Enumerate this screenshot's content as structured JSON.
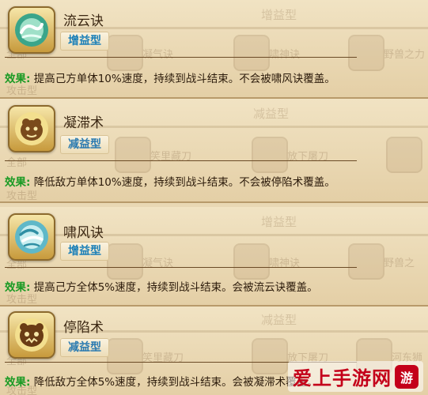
{
  "skills": [
    {
      "name": "流云诀",
      "type": "增益型",
      "effect_label": "效果:",
      "effect_text": "提高己方单体10%速度，持续到战斗结束。不会被啸风诀覆盖。",
      "icon": "cloud-swirl-icon",
      "ghost": {
        "header": "增益型",
        "left_tabs": [
          "全部",
          "攻击型"
        ],
        "cells": [
          "凝气诀",
          "啸神诀",
          "野兽之力"
        ]
      }
    },
    {
      "name": "凝滞术",
      "type": "减益型",
      "effect_label": "效果:",
      "effect_text": "降低敌方单体10%速度，持续到战斗结束。不会被停陷术覆盖。",
      "icon": "beast-claw-icon",
      "ghost": {
        "header": "减益型",
        "left_tabs": [
          "全部",
          "攻击型"
        ],
        "cells": [
          "笑里藏刀",
          "放下屠刀"
        ]
      }
    },
    {
      "name": "啸风诀",
      "type": "增益型",
      "effect_label": "效果:",
      "effect_text": "提高己方全体5%速度，持续到战斗结束。会被流云诀覆盖。",
      "icon": "wind-swirl-icon",
      "ghost": {
        "header": "增益型",
        "left_tabs": [
          "全部",
          "攻击型"
        ],
        "cells": [
          "凝气诀",
          "啸神诀",
          "野兽之"
        ]
      }
    },
    {
      "name": "停陷术",
      "type": "减益型",
      "effect_label": "效果:",
      "effect_text": "降低敌方全体5%速度，持续到战斗结束。会被凝滞术覆盖。",
      "icon": "beast-mask-icon",
      "ghost": {
        "header": "减益型",
        "left_tabs": [
          "全部",
          "攻击型"
        ],
        "cells": [
          "笑里藏刀",
          "放下屠刀",
          "河东狮"
        ]
      }
    }
  ],
  "watermark": {
    "text": "爱上手游网",
    "logo": "游"
  },
  "colors": {
    "buff": "#1a7fb8",
    "effect_label": "#1a9a24",
    "panel": "#efe0bf"
  }
}
